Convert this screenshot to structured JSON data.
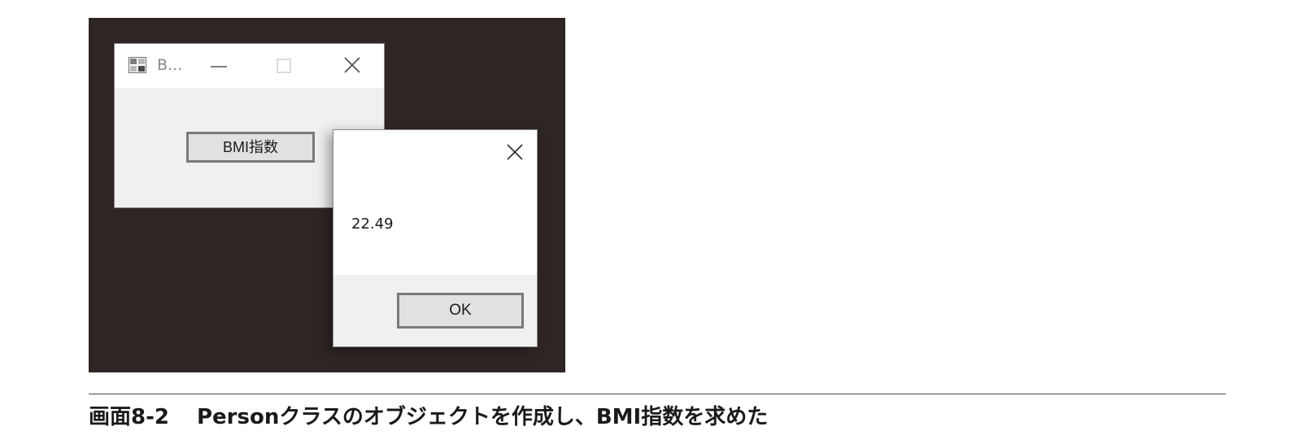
{
  "form_window": {
    "title": "B...",
    "icon": "winforms-app-icon",
    "controls": [
      "minimize-icon",
      "maximize-icon",
      "close-icon"
    ],
    "button_label": "BMI指数"
  },
  "message_box": {
    "message": "22.49",
    "ok_label": "OK",
    "close_icon": "close-icon"
  },
  "caption": {
    "number": "画面8-2",
    "text": "Personクラスのオブジェクトを作成し、BMI指数を求めた"
  },
  "colors": {
    "desktop_background": "#2e2624",
    "window_body": "#f0f0f0",
    "titlebar": "#ffffff",
    "button_face": "#e1e1e1",
    "button_border": "#7a7a7a"
  }
}
